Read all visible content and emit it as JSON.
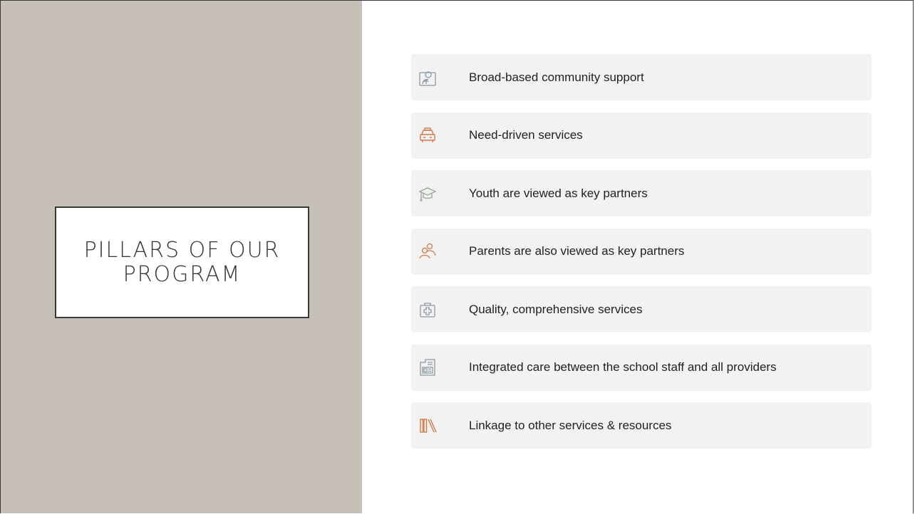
{
  "slide": {
    "title_line1": "PILLARS OF OUR",
    "title_line2": "PROGRAM"
  },
  "colors": {
    "left_panel": "#c6c0b9",
    "item_background": "#f2f2f2",
    "icon_gray": "#8c9aa3",
    "icon_orange": "#d07a48",
    "icon_sage": "#9aa98f"
  },
  "pillars": [
    {
      "label": "Broad-based community support",
      "icon": "community-portrait-icon"
    },
    {
      "label": "Need-driven services",
      "icon": "taxi-car-icon"
    },
    {
      "label": "Youth are viewed as key partners",
      "icon": "graduation-cap-icon"
    },
    {
      "label": "Parents are also viewed as key partners",
      "icon": "two-people-icon"
    },
    {
      "label": "Quality, comprehensive services",
      "icon": "first-aid-kit-icon"
    },
    {
      "label": "Integrated care between the school staff and all providers",
      "icon": "id-card-folder-icon"
    },
    {
      "label": "Linkage to other services & resources",
      "icon": "books-shelf-icon"
    }
  ]
}
